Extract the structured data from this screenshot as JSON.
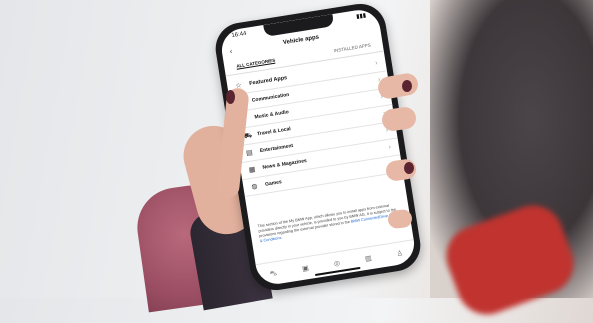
{
  "status_bar": {
    "time": "16:44",
    "signal": "▮▮▮"
  },
  "header": {
    "back_icon": "chevron-left",
    "title": "Vehicle apps"
  },
  "tabs": [
    {
      "label": "ALL CATEGORIES",
      "active": true
    },
    {
      "label": "INSTALLED APPS",
      "active": false
    }
  ],
  "categories": [
    {
      "icon": "star",
      "label": "Featured Apps"
    },
    {
      "icon": "speech-bubble",
      "label": "Communication"
    },
    {
      "icon": "music-note",
      "label": "Music & Audio"
    },
    {
      "icon": "car",
      "label": "Travel & Local"
    },
    {
      "icon": "screen",
      "label": "Entertainment"
    },
    {
      "icon": "newspaper",
      "label": "News & Magazines"
    },
    {
      "icon": "gamepad",
      "label": "Games"
    }
  ],
  "disclaimer": {
    "text": "This section of the My BMW App, which allows you to install apps from external providers directly in your vehicle, is provided to you by BMW AG. It is subject to the provisions regarding the external provider stored in the",
    "link": "BMW ConnectedDrive Terms & Conditions."
  },
  "bottom_nav": [
    "car",
    "box",
    "globe",
    "map",
    "person"
  ],
  "colors": {
    "link": "#1c69d4",
    "nail": "#5a2430",
    "strap": "#c0332f"
  }
}
